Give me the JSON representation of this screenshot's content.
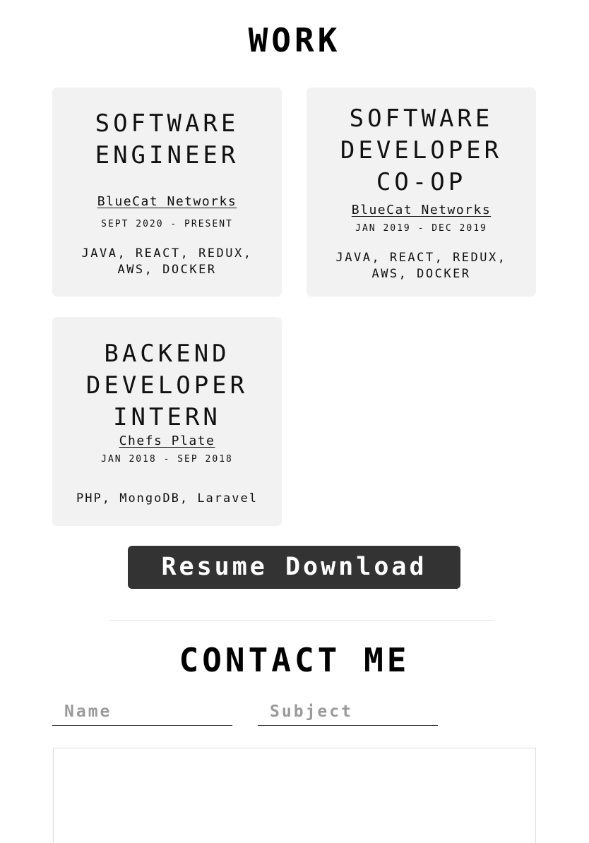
{
  "work": {
    "title": "WORK",
    "jobs": [
      {
        "title_lines": [
          "SOFTWARE",
          "ENGINEER"
        ],
        "company": "BlueCat Networks",
        "dates": "SEPT 2020 - PRESENT",
        "tech_lines": [
          "JAVA, REACT, REDUX,",
          "AWS, DOCKER"
        ]
      },
      {
        "title_lines": [
          "SOFTWARE",
          "DEVELOPER",
          "CO-OP"
        ],
        "company": "BlueCat Networks",
        "dates": "JAN 2019 - DEC 2019",
        "tech_lines": [
          "JAVA, REACT, REDUX,",
          "AWS, DOCKER"
        ]
      },
      {
        "title_lines": [
          "BACKEND",
          "DEVELOPER",
          "INTERN"
        ],
        "company": "Chefs Plate",
        "dates": "JAN 2018 - SEP 2018",
        "tech_lines": [
          "PHP, MongoDB, Laravel"
        ]
      }
    ],
    "resume_button": "Resume Download"
  },
  "contact": {
    "title": "CONTACT ME",
    "name_placeholder": "Name",
    "subject_placeholder": "Subject",
    "name_value": "",
    "subject_value": "",
    "message_value": ""
  }
}
